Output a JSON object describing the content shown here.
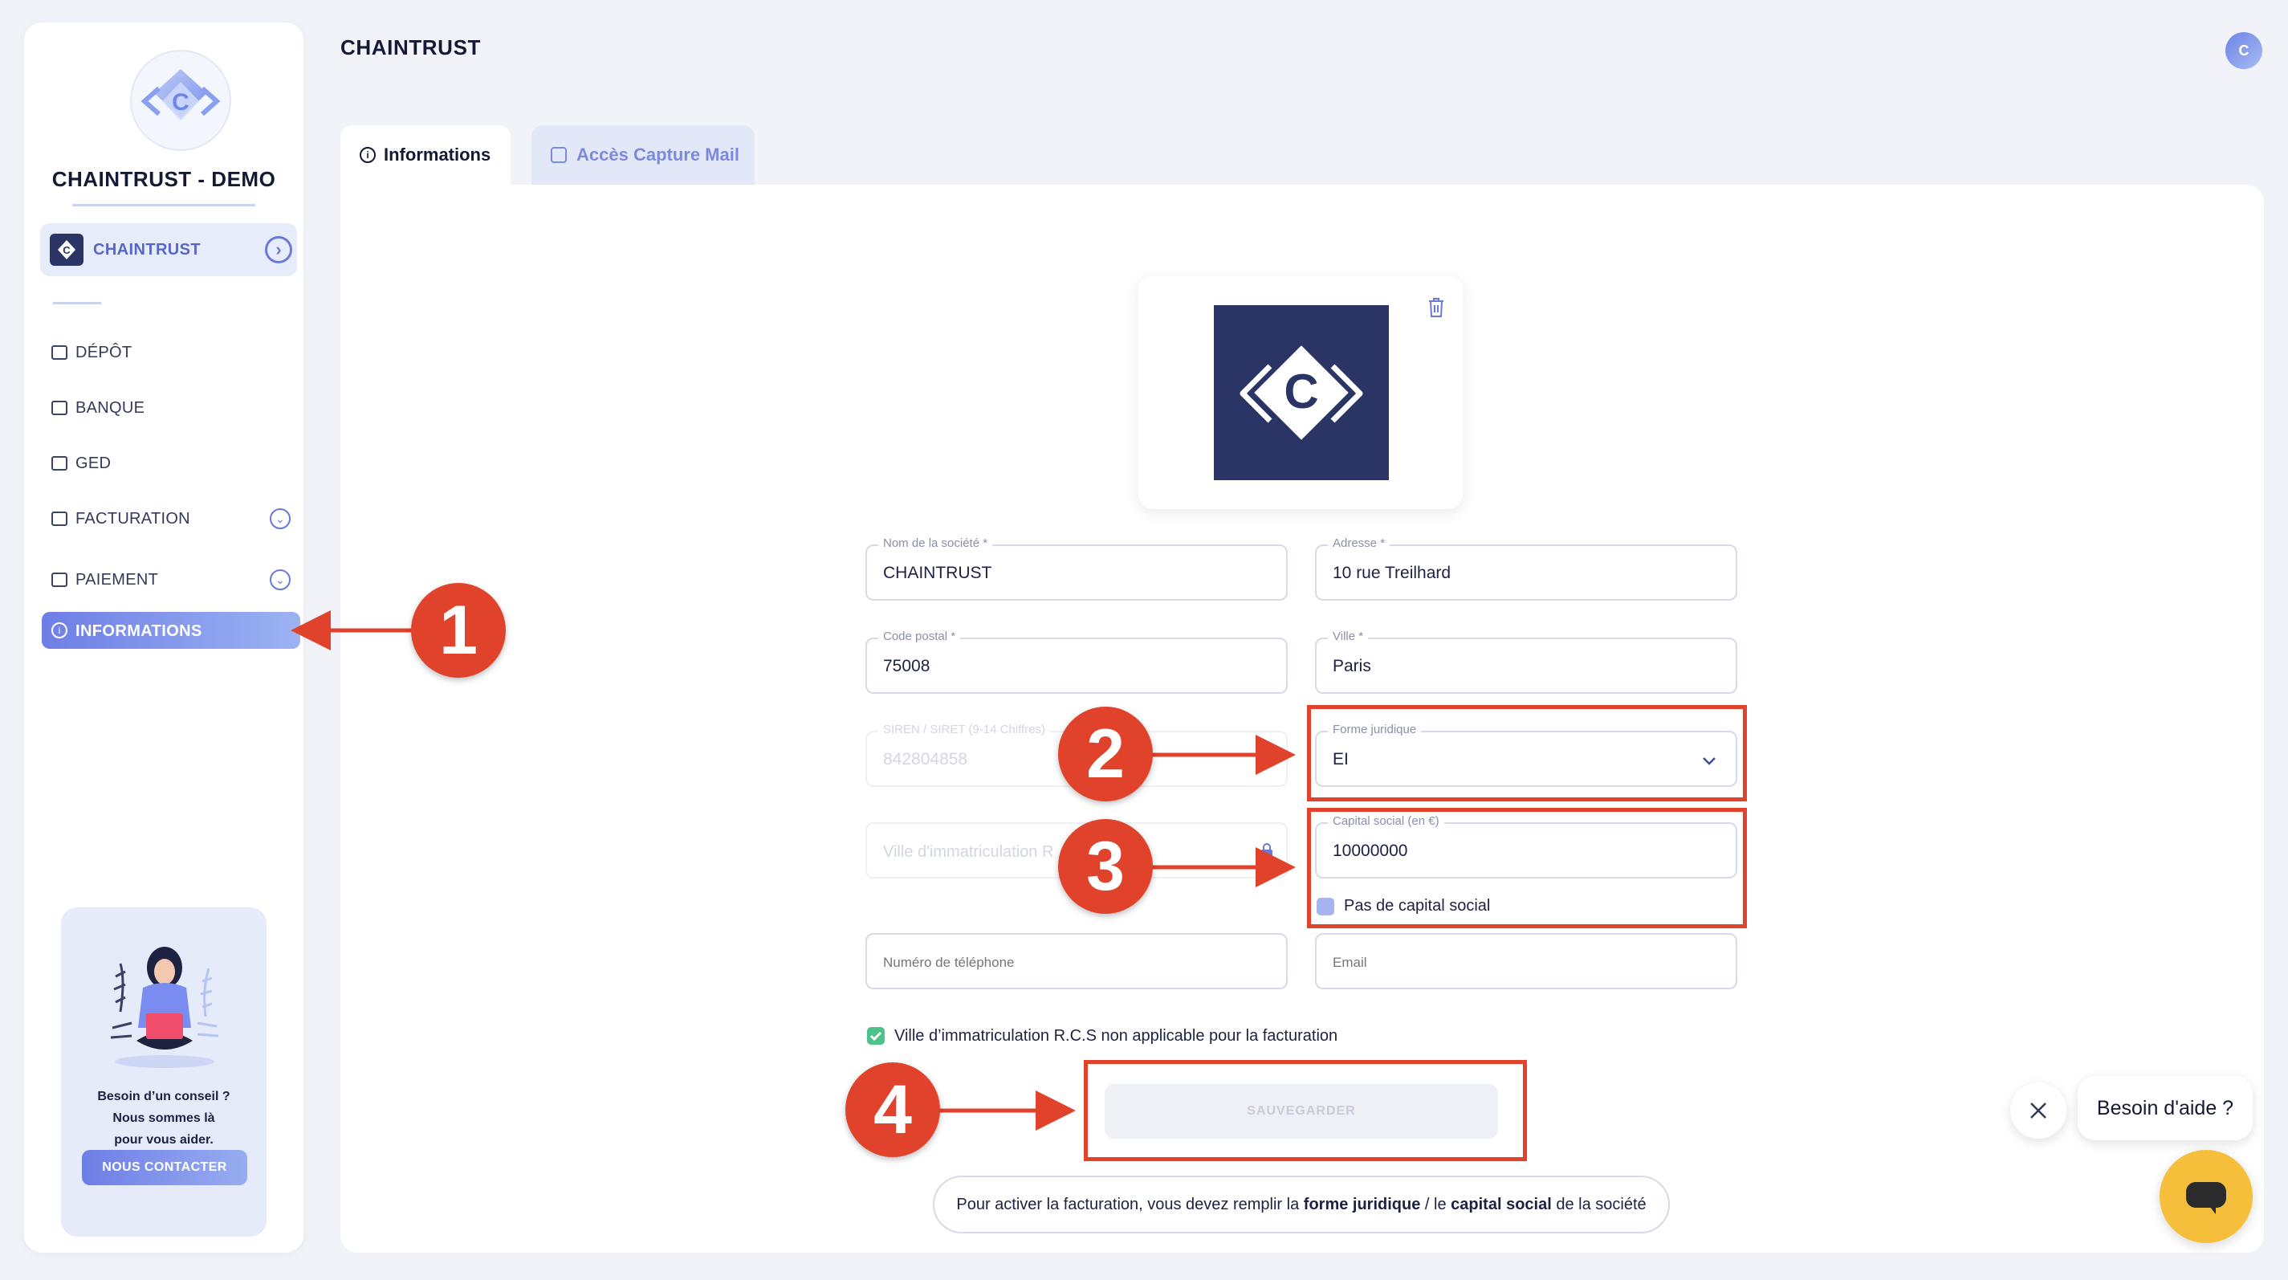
{
  "sidebar": {
    "org_name": "CHAINTRUST - DEMO",
    "company": {
      "label": "CHAINTRUST",
      "logo_letter": "C",
      "icon": "chevron-right-circle-icon"
    },
    "items": [
      {
        "label": "DÉPÔT",
        "icon": "folder-icon"
      },
      {
        "label": "BANQUE",
        "icon": "bank-icon"
      },
      {
        "label": "GED",
        "icon": "document-icon"
      },
      {
        "label": "FACTURATION",
        "icon": "invoice-icon",
        "expandable": true
      },
      {
        "label": "PAIEMENT",
        "icon": "card-icon",
        "expandable": true
      },
      {
        "label": "INFORMATIONS",
        "icon": "info-icon",
        "active": true
      }
    ],
    "help": {
      "line1": "Besoin d’un conseil ?",
      "line2": "Nous sommes là",
      "line3": "pour vous aider.",
      "button": "NOUS CONTACTER"
    }
  },
  "header": {
    "title": "CHAINTRUST",
    "avatar_letter": "C"
  },
  "tabs": [
    {
      "label": "Informations",
      "active": true,
      "icon": "info-icon"
    },
    {
      "label": "Accès Capture Mail",
      "active": false,
      "icon": "mail-icon"
    }
  ],
  "form": {
    "logo_letter": "C",
    "company_name": {
      "label": "Nom de la société *",
      "value": "CHAINTRUST"
    },
    "address": {
      "label": "Adresse *",
      "value": "10 rue Treilhard"
    },
    "postal_code": {
      "label": "Code postal *",
      "value": "75008"
    },
    "city": {
      "label": "Ville *",
      "value": "Paris"
    },
    "siren": {
      "label": "SIREN / SIRET (9-14 Chiffres)",
      "value": "842804858"
    },
    "legal_form": {
      "label": "Forme juridique",
      "value": "EI"
    },
    "rcs_city": {
      "placeholder": "Ville d'immatriculation R"
    },
    "capital": {
      "label": "Capital social (en €)",
      "value": "10000000"
    },
    "no_capital": {
      "label": "Pas de capital social",
      "checked": false
    },
    "phone": {
      "placeholder": "Numéro de téléphone"
    },
    "email": {
      "placeholder": "Email"
    },
    "rcs_na": {
      "label": "Ville d’immatriculation R.C.S non applicable pour la facturation",
      "checked": true
    },
    "save_label": "SAUVEGARDER",
    "notice": {
      "prefix": "Pour activer la facturation, vous devez remplir la ",
      "bold1": "forme juridique",
      "mid": " / le ",
      "bold2": "capital social",
      "suffix": " de la société"
    }
  },
  "annotations": [
    "1",
    "2",
    "3",
    "4"
  ],
  "chat": {
    "bubble": "Besoin d'aide ?"
  },
  "colors": {
    "accent": "#6e7ee6",
    "annotation_red": "#e0422b",
    "success_green": "#4cc38a",
    "chat_yellow": "#f5bf3c",
    "brand_navy": "#2a3566"
  }
}
